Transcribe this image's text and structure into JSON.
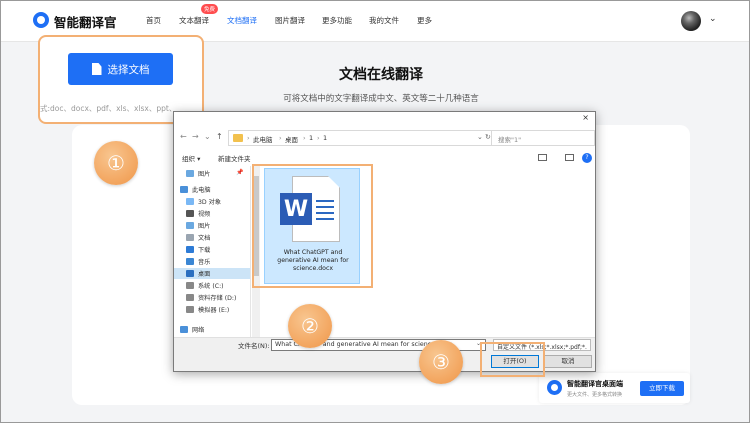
{
  "header": {
    "brand": "智能翻译官",
    "nav": [
      {
        "label": "首页",
        "active": false
      },
      {
        "label": "文本翻译",
        "active": false,
        "badge": "免费"
      },
      {
        "label": "文档翻译",
        "active": true
      },
      {
        "label": "图片翻译",
        "active": false
      },
      {
        "label": "更多功能",
        "active": false
      },
      {
        "label": "我的文件",
        "active": false
      },
      {
        "label": "更多",
        "active": false
      }
    ],
    "avatar_icon": "user-avatar",
    "menu_icon": "chevron-down-icon"
  },
  "main": {
    "title": "文档在线翻译",
    "subtitle": "可将文档中的文字翻译成中文、英文等二十几种语言"
  },
  "upload": {
    "button_label": "选择文档",
    "formats": "式:doc、docx、pdf、xls、xlsx、ppt、"
  },
  "markers": [
    "①",
    "②",
    "③"
  ],
  "dialog": {
    "close": "×",
    "path": [
      "此电脑",
      "桌面",
      "1",
      "1"
    ],
    "search_placeholder": "搜索\"1\"",
    "toolbar": {
      "organize": "组织 ▾",
      "new_folder": "新建文件夹"
    },
    "tree": [
      {
        "label": "图片",
        "icon": "pictures-icon",
        "pinned": true
      },
      {
        "label": "此电脑",
        "icon": "computer-icon"
      },
      {
        "label": "3D 对象",
        "icon": "3d-objects-icon"
      },
      {
        "label": "视频",
        "icon": "video-icon"
      },
      {
        "label": "图片",
        "icon": "pictures-icon"
      },
      {
        "label": "文档",
        "icon": "documents-icon"
      },
      {
        "label": "下载",
        "icon": "download-icon"
      },
      {
        "label": "音乐",
        "icon": "music-icon"
      },
      {
        "label": "桌面",
        "icon": "desktop-icon",
        "selected": true
      },
      {
        "label": "系统 (C:)",
        "icon": "drive-icon"
      },
      {
        "label": "资料存储 (D:)",
        "icon": "drive-icon"
      },
      {
        "label": "模拟器 (E:)",
        "icon": "drive-icon"
      },
      {
        "label": "网络",
        "icon": "network-icon"
      }
    ],
    "file": {
      "name": "What ChatGPT and generative AI mean for science.docx",
      "icon": "word-document-icon"
    },
    "filename_label": "文件名(N):",
    "filename_value": "What ChatGPT and generative AI mean for science.docx",
    "filetype": "自定义文件 (*.xls;*.xlsx;*.pdf;*.",
    "open_label": "打开(O)",
    "cancel_label": "取消"
  },
  "promo": {
    "title": "智能翻译官桌面端",
    "subtitle": "更大文件、更多格式转换",
    "button": "立即下载"
  },
  "colors": {
    "accent": "#1e6ff5",
    "highlight": "#f3b074",
    "badge": "#ff4d4f"
  }
}
